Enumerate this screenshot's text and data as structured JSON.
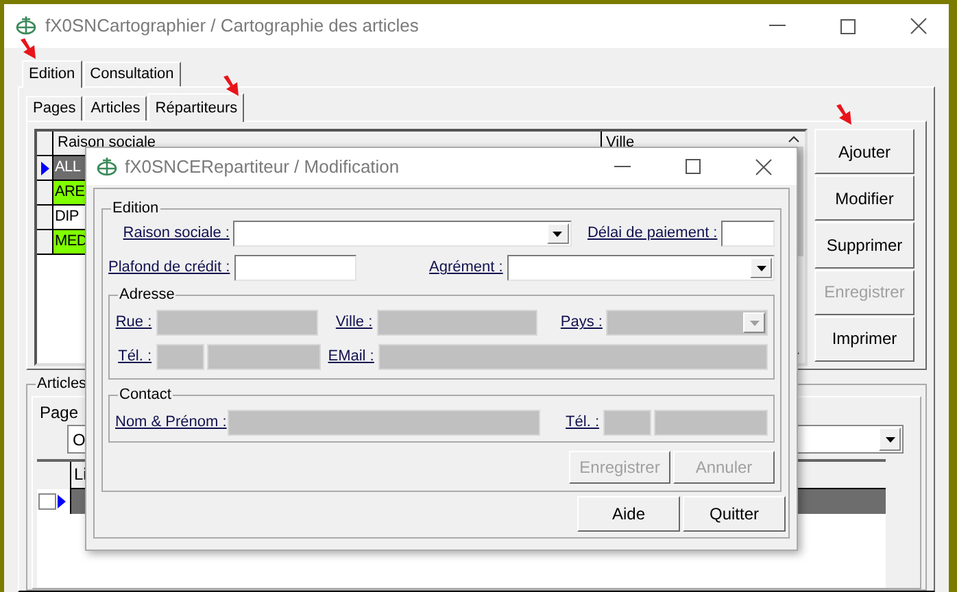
{
  "window": {
    "title": "fX0SNCartographier / Cartographie des articles"
  },
  "main_tabs": [
    {
      "label": "Edition",
      "selected": true
    },
    {
      "label": "Consultation",
      "selected": false
    }
  ],
  "sub_tabs": [
    {
      "label": "Pages",
      "selected": false
    },
    {
      "label": "Articles",
      "selected": false
    },
    {
      "label": "Répartiteurs",
      "selected": true
    }
  ],
  "grid": {
    "columns": [
      "Raison sociale",
      "Ville"
    ],
    "rows": [
      {
        "cell": "ALL",
        "selected": true,
        "color": "#6d6d6d"
      },
      {
        "cell": "ARE",
        "selected": false,
        "color": "#80ff00"
      },
      {
        "cell": "DIP",
        "selected": false,
        "color": "#ffffff"
      },
      {
        "cell": "MED",
        "selected": false,
        "color": "#80ff00"
      }
    ]
  },
  "side_buttons": [
    {
      "label": "Ajouter",
      "disabled": false
    },
    {
      "label": "Modifier",
      "disabled": false
    },
    {
      "label": "Supprimer",
      "disabled": false
    },
    {
      "label": "Enregistrer",
      "disabled": true
    },
    {
      "label": "Imprimer",
      "disabled": false
    }
  ],
  "articles": {
    "legend": "Articles",
    "tab": "Page",
    "combo_value": "O",
    "columns": [
      "Li"
    ],
    "row_checked": false
  },
  "dialog": {
    "title": "fX0SNCERepartiteur / Modification",
    "edition": {
      "legend": "Edition",
      "fields": [
        {
          "label": "Raison sociale :",
          "kind": "combo",
          "disabled": false
        },
        {
          "label": "Délai de paiement :",
          "kind": "text",
          "disabled": false
        },
        {
          "label": "Plafond de crédit :",
          "kind": "text",
          "disabled": false
        },
        {
          "label": "Agrément :",
          "kind": "combo",
          "disabled": false
        }
      ]
    },
    "address": {
      "legend": "Adresse",
      "fields": [
        {
          "label": "Rue :",
          "kind": "text",
          "disabled": true
        },
        {
          "label": "Ville :",
          "kind": "text",
          "disabled": true
        },
        {
          "label": "Pays :",
          "kind": "combo",
          "disabled": true
        },
        {
          "label": "Tél. :",
          "kind": "phone",
          "disabled": true
        },
        {
          "label": "EMail :",
          "kind": "text",
          "disabled": true
        }
      ]
    },
    "contact": {
      "legend": "Contact",
      "fields": [
        {
          "label": "Nom & Prénom :",
          "kind": "text",
          "disabled": true
        },
        {
          "label": "Tél. :",
          "kind": "phone",
          "disabled": true
        }
      ]
    },
    "form_buttons": [
      {
        "label": "Enregistrer",
        "disabled": true
      },
      {
        "label": "Annuler",
        "disabled": true
      }
    ],
    "buttons": [
      {
        "label": "Aide",
        "disabled": false
      },
      {
        "label": "Quitter",
        "disabled": false
      }
    ]
  }
}
